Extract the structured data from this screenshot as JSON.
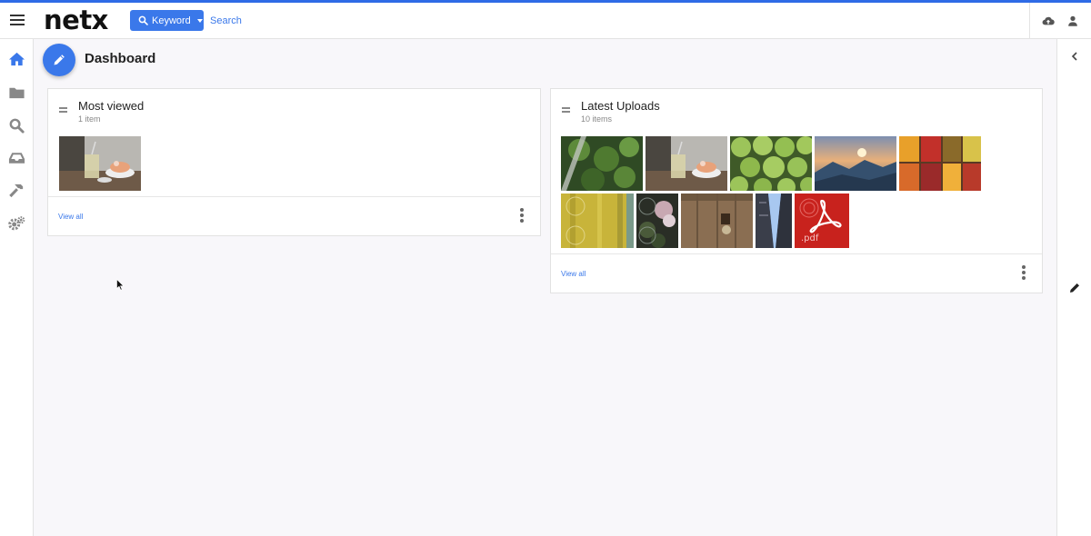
{
  "app": {
    "logo_text": "netx",
    "accent_color": "#3a78ea"
  },
  "header": {
    "search_mode_label": "Keyword",
    "search_placeholder": "Search",
    "search_value": "",
    "icons": [
      "menu-icon",
      "search-icon",
      "cloud-upload-icon",
      "user-icon"
    ]
  },
  "sidebar": {
    "items": [
      {
        "icon": "home-icon",
        "active": true
      },
      {
        "icon": "folder-icon",
        "active": false
      },
      {
        "icon": "search-icon",
        "active": false
      },
      {
        "icon": "inbox-icon",
        "active": false
      },
      {
        "icon": "hammer-icon",
        "active": false
      },
      {
        "icon": "gears-icon",
        "active": false
      }
    ]
  },
  "page": {
    "title": "Dashboard"
  },
  "widgets": {
    "most_viewed": {
      "title": "Most viewed",
      "count_label": "1 item",
      "view_all_label": "View all",
      "thumbnails": [
        "drinks-and-cake"
      ]
    },
    "latest_uploads": {
      "title": "Latest Uploads",
      "count_label": "10 items",
      "view_all_label": "View all",
      "thumbnails": [
        "green-foliage",
        "drinks-and-cake",
        "brussels-sprouts",
        "mountain-sunset",
        "fruit-market",
        "yellow-document",
        "forest-flowers",
        "wooden-table",
        "city-towers",
        "pdf-file"
      ],
      "pdf_label": ".pdf"
    }
  }
}
